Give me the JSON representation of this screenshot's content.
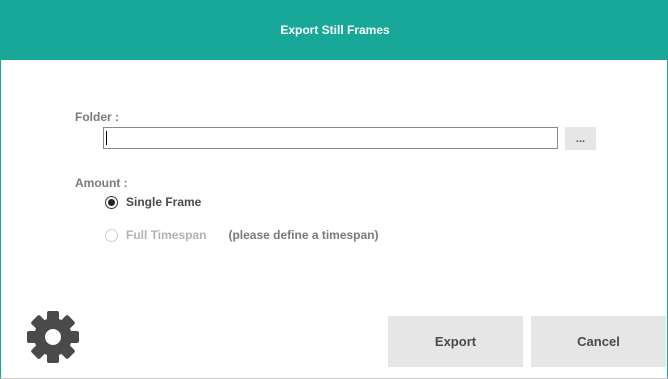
{
  "dialog": {
    "title": "Export Still Frames"
  },
  "folder": {
    "label": "Folder :",
    "value": "",
    "browse_label": "..."
  },
  "amount": {
    "label": "Amount :",
    "options": [
      {
        "label": "Single Frame",
        "checked": true,
        "enabled": true
      },
      {
        "label": "Full Timespan",
        "checked": false,
        "enabled": false
      }
    ],
    "hint": "(please define a timespan)"
  },
  "footer": {
    "settings_icon": "gear-icon",
    "export_label": "Export",
    "cancel_label": "Cancel"
  },
  "colors": {
    "accent": "#18a89a",
    "button_bg": "#e6e6e6"
  }
}
